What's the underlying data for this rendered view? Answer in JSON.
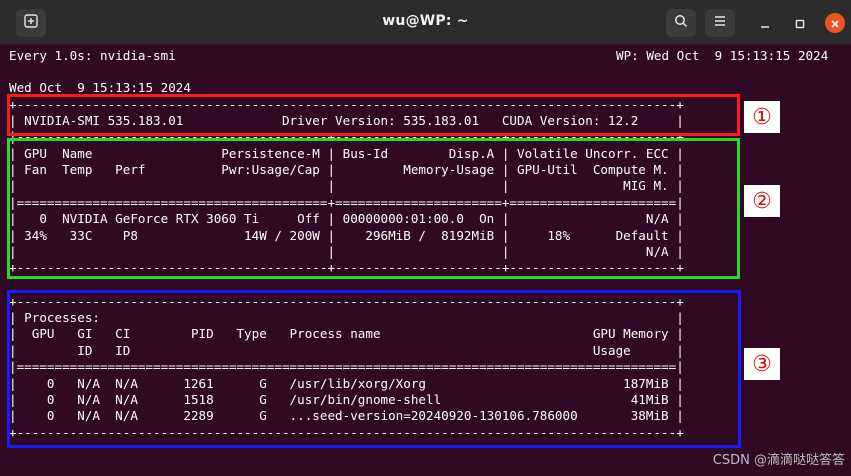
{
  "window": {
    "title": "wu@WP: ~",
    "buttons": {
      "new_tab_icon": "new-tab-icon",
      "search_icon": "search-icon",
      "menu_icon": "hamburger-menu-icon",
      "minimize_icon": "minimize-icon",
      "maximize_icon": "maximize-icon",
      "close_icon": "close-icon"
    },
    "accent_close": "#e95420"
  },
  "terminal": {
    "watch_header_left": "Every 1.0s: nvidia-smi",
    "watch_header_right": "WP: Wed Oct  9 15:13:15 2024",
    "timestamp": "Wed Oct  9 15:13:15 2024",
    "section1": [
      "+---------------------------------------------------------------------------------------+",
      "| NVIDIA-SMI 535.183.01             Driver Version: 535.183.01   CUDA Version: 12.2     |"
    ],
    "section2": [
      "|-----------------------------------------+----------------------+----------------------+",
      "| GPU  Name                 Persistence-M | Bus-Id        Disp.A | Volatile Uncorr. ECC |",
      "| Fan  Temp   Perf          Pwr:Usage/Cap |         Memory-Usage | GPU-Util  Compute M. |",
      "|                                         |                      |               MIG M. |",
      "|=========================================+======================+======================|",
      "|   0  NVIDIA GeForce RTX 3060 Ti     Off | 00000000:01:00.0  On |                  N/A |",
      "| 34%   33C    P8              14W / 200W |    296MiB /  8192MiB |     18%      Default |",
      "|                                         |                      |                  N/A |",
      "+-----------------------------------------+----------------------+----------------------+"
    ],
    "section3": [
      "+---------------------------------------------------------------------------------------+",
      "| Processes:                                                                            |",
      "|  GPU   GI   CI        PID   Type   Process name                            GPU Memory |",
      "|        ID   ID                                                             Usage      |",
      "|=======================================================================================|",
      "|    0   N/A  N/A      1261      G   /usr/lib/xorg/Xorg                          187MiB |",
      "|    0   N/A  N/A      1518      G   /usr/bin/gnome-shell                         41MiB |",
      "|    0   N/A  N/A      2289      G   ...seed-version=20240920-130106.786000       38MiB |",
      "+---------------------------------------------------------------------------------------+"
    ]
  },
  "annotations": {
    "markers": [
      "①",
      "②",
      "③"
    ],
    "colors": {
      "box1": "#ff1a1a",
      "box2": "#22dd22",
      "box3": "#1a1aff"
    }
  },
  "watermark": "CSDN @滴滴哒哒答答"
}
